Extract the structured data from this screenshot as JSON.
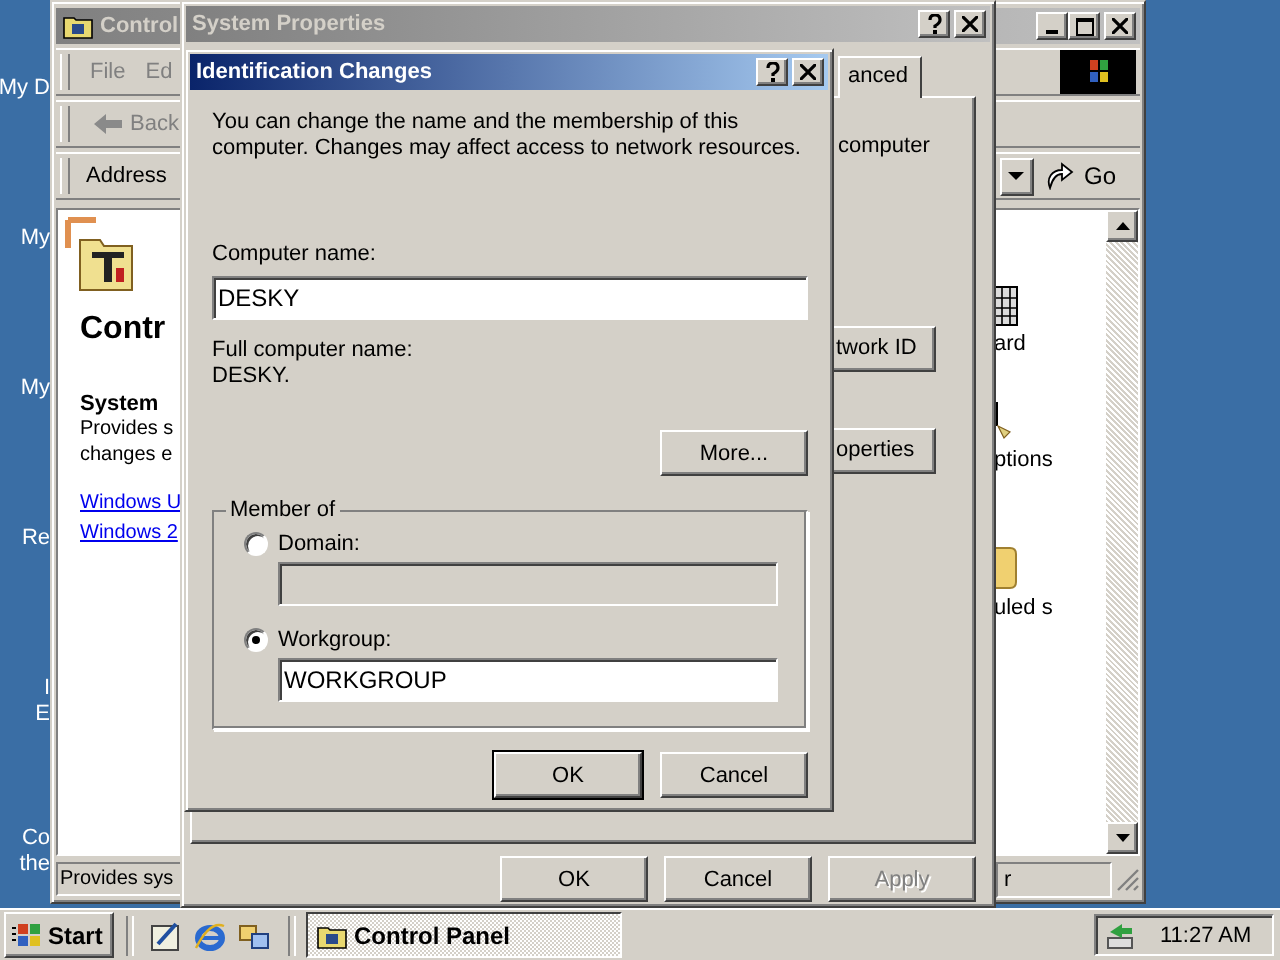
{
  "desktop": {
    "icon_labels": [
      {
        "lines": [
          "My D"
        ]
      },
      {
        "lines": [
          "My"
        ]
      },
      {
        "lines": [
          "My"
        ]
      },
      {
        "lines": [
          "Re"
        ]
      },
      {
        "lines": [
          "I",
          "E"
        ]
      },
      {
        "lines": [
          "Co",
          "the"
        ]
      }
    ]
  },
  "control_panel": {
    "title": "Control",
    "menu": [
      "File",
      "Ed"
    ],
    "back": "Back",
    "address_label": "Address",
    "go": "Go",
    "panel": {
      "heading": "Contr",
      "item_title": "System",
      "description": [
        "Provides s",
        "changes e"
      ],
      "links": [
        "Windows U",
        "Windows 2"
      ]
    },
    "list_fragments": [
      {
        "kind": "keyboard",
        "label": "ard"
      },
      {
        "kind": "mouse",
        "label": "ptions"
      },
      {
        "kind": "folder",
        "label": "uled s"
      }
    ],
    "status": [
      "Provides sys",
      "r"
    ]
  },
  "system_properties": {
    "title": "System Properties",
    "tab": {
      "label": "anced",
      "selected": true
    },
    "text": "computer",
    "buttons": [
      "twork ID",
      "operties"
    ],
    "footer": [
      {
        "label": "OK",
        "disabled": false
      },
      {
        "label": "Cancel",
        "disabled": false
      },
      {
        "label": "Apply",
        "disabled": true
      }
    ]
  },
  "dialog": {
    "title": "Identification Changes",
    "intro": "You can change the name and the membership of this computer. Changes may affect access to network resources.",
    "computer_name": {
      "label": "Computer name:",
      "value": "DESKY"
    },
    "full_name": {
      "label": "Full computer name:",
      "value": "DESKY."
    },
    "more": "More...",
    "member_of": {
      "legend": "Member of",
      "options": [
        {
          "label": "Domain:",
          "selected": false,
          "field_disabled": true
        },
        {
          "label": "Workgroup:",
          "selected": true,
          "field_disabled": false,
          "value": "WORKGROUP"
        }
      ]
    },
    "buttons": [
      {
        "label": "OK",
        "default": true
      },
      {
        "label": "Cancel",
        "default": false
      }
    ]
  },
  "taskbar": {
    "start": "Start",
    "tasks": [
      {
        "label": "Control Panel",
        "selected": true
      }
    ],
    "clock": "11:27 AM"
  }
}
